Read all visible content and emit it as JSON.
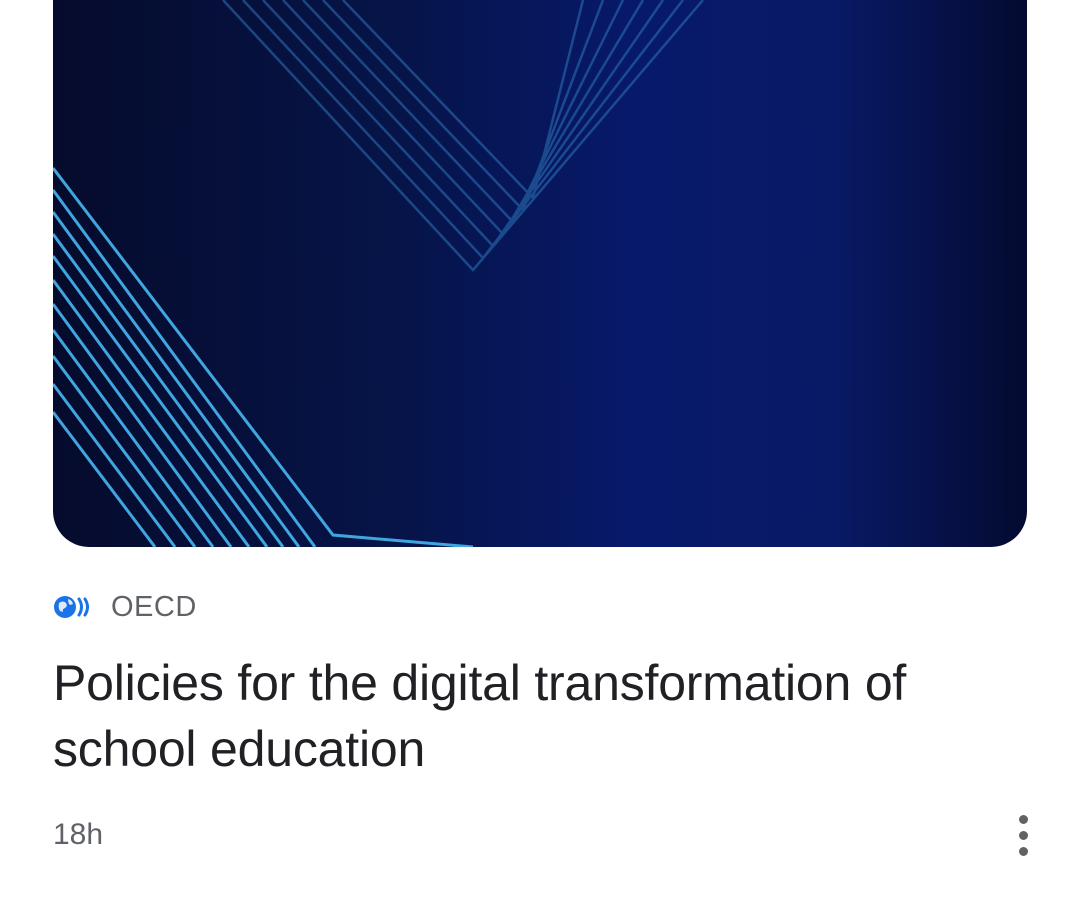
{
  "article": {
    "source": "OECD",
    "source_logo_icon": "oecd-globe-icon",
    "title": "Policies for the digital transformation of school education",
    "time": "18h",
    "menu_icon": "more-vert-icon"
  },
  "colors": {
    "title_text": "#202124",
    "secondary_text": "#5f6368",
    "logo_blue": "#1a73e8",
    "image_line": "#3aa0d8"
  }
}
